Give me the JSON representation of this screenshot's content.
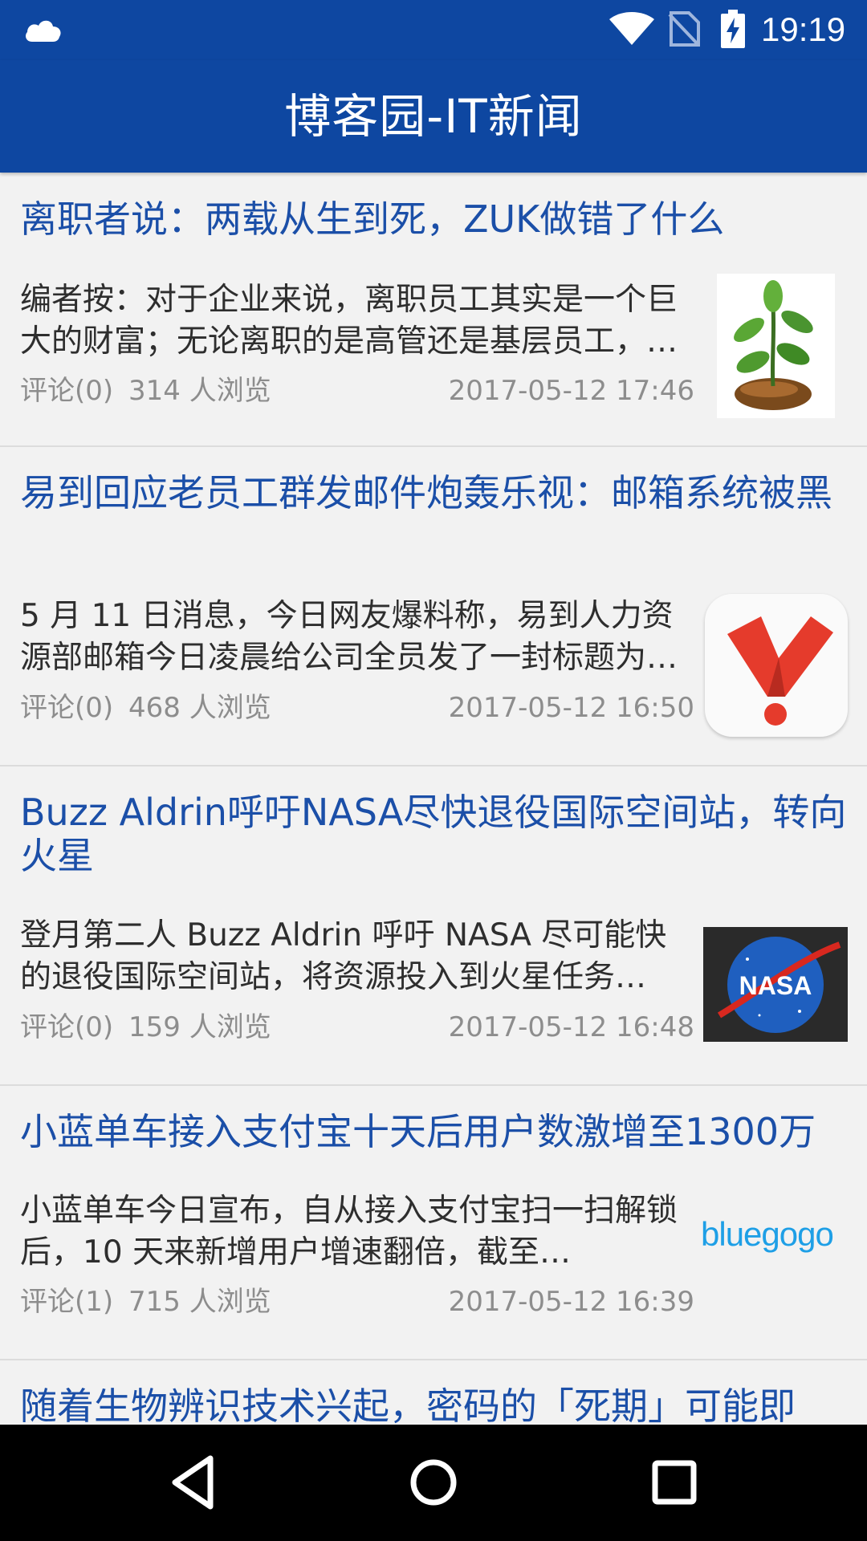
{
  "status_bar": {
    "time": "19:19",
    "icons": [
      "cloud-icon",
      "wifi-icon",
      "no-sim-icon",
      "battery-charging-icon"
    ]
  },
  "app_bar": {
    "title": "博客园-IT新闻"
  },
  "news": [
    {
      "title": "离职者说：两载从生到死，ZUK做错了什么",
      "summary": "编者按：对于企业来说，离职员工其实是一个巨大的财富；无论离职的是高管还是基层员工，他们都…",
      "comments": "评论(0)",
      "views": "314 人浏览",
      "date": "2017-05-12 17:46",
      "thumb": "sprout-image"
    },
    {
      "title": "易到回应老员工群发邮件炮轰乐视：邮箱系统被黑",
      "summary": "5 月 11 日消息，今日网友爆料称，易到人力资源部邮箱今日凌晨给公司全员发了一封标题为…",
      "comments": "评论(0)",
      "views": "468 人浏览",
      "date": "2017-05-12 16:50",
      "thumb": "yidao-logo"
    },
    {
      "title": "Buzz Aldrin呼吁NASA尽快退役国际空间站，转向火星",
      "summary": "登月第二人 Buzz Aldrin 呼吁 NASA 尽可能快的退役国际空间站，将资源投入到火星任务…",
      "comments": "评论(0)",
      "views": "159 人浏览",
      "date": "2017-05-12 16:48",
      "thumb": "nasa-logo",
      "thumb_text": "NASA"
    },
    {
      "title": "小蓝单车接入支付宝十天后用户数激增至1300万",
      "summary": "小蓝单车今日宣布，自从接入支付宝扫一扫解锁后，10 天来新增用户增速翻倍，截至…",
      "comments": "评论(1)",
      "views": "715 人浏览",
      "date": "2017-05-12 16:39",
      "thumb": "bluegogo-logo",
      "thumb_text": "bluegogo"
    },
    {
      "title": "随着生物辨识技术兴起，密码的「死期」可能即"
    }
  ],
  "colors": {
    "primary": "#0e47a1",
    "title_text": "#1b4fa8",
    "meta_text": "#8d8d8d"
  },
  "nav_bar": {
    "icons": [
      "back-icon",
      "home-icon",
      "recents-icon"
    ]
  }
}
